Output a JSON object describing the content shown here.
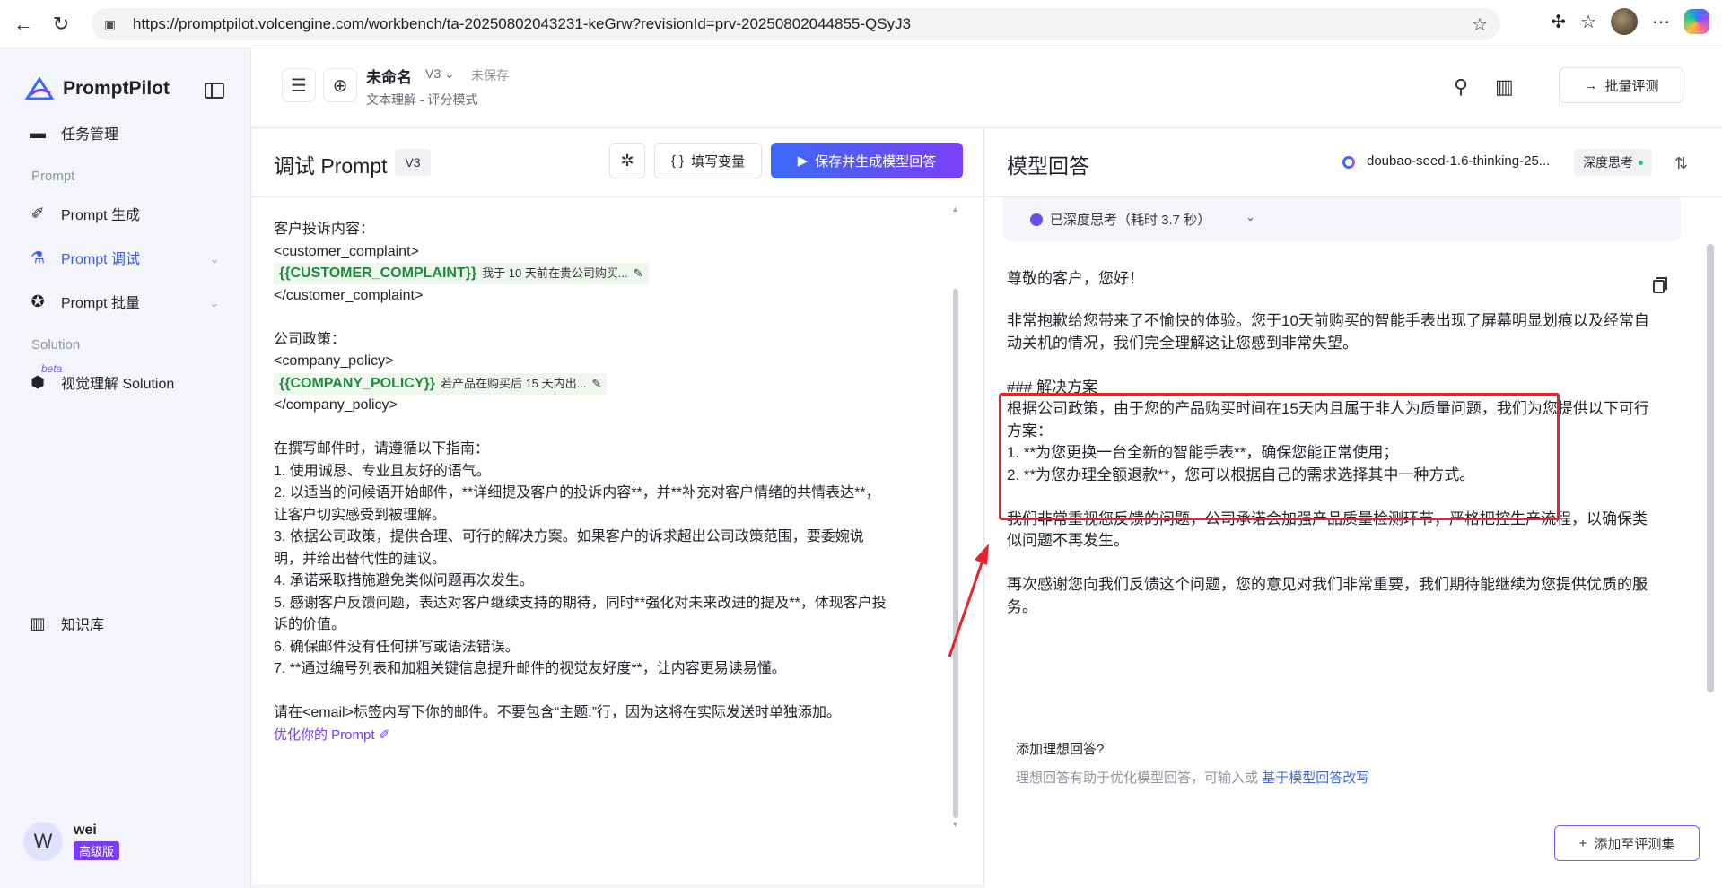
{
  "browser": {
    "url": "https://promptpilot.volcengine.com/workbench/ta-20250802043231-keGrw?revisionId=prv-20250802044855-QSyJ3"
  },
  "sidebar": {
    "logo": "PromptPilot",
    "items": [
      {
        "label": "任务管理"
      },
      {
        "label": "Prompt 生成"
      },
      {
        "label": "Prompt 调试"
      },
      {
        "label": "Prompt 批量"
      },
      {
        "label": "视觉理解 Solution"
      },
      {
        "label": "知识库"
      }
    ],
    "section_prompt": "Prompt",
    "section_solution": "Solution",
    "beta": "beta",
    "user": {
      "initial": "W",
      "name": "wei",
      "badge": "高级版"
    }
  },
  "header": {
    "title": "未命名",
    "version": "V3",
    "status": "未保存",
    "subtitle": "文本理解 - 评分模式",
    "batch_button": "批量评测"
  },
  "left": {
    "title": "调试 Prompt",
    "version": "V3",
    "fill_vars": "填写变量",
    "save_button": "保存并生成模型回答",
    "lines": {
      "l1": "客户投诉内容：",
      "l2": "<customer_complaint>",
      "var1_name": "{{CUSTOMER_COMPLAINT}}",
      "var1_val": "我于 10 天前在贵公司购买...",
      "l4": "</customer_complaint>",
      "l6": "公司政策：",
      "l7": "<company_policy>",
      "var2_name": "{{COMPANY_POLICY}}",
      "var2_val": "若产品在购买后 15 天内出...",
      "l9": "</company_policy>",
      "l11": "在撰写邮件时，请遵循以下指南：",
      "l12": "1. 使用诚恳、专业且友好的语气。",
      "l13": "2. 以适当的问候语开始邮件，**详细提及客户的投诉内容**，并**补充对客户情绪的共情表达**，",
      "l14": "让客户切实感受到被理解。",
      "l15": "3. 依据公司政策，提供合理、可行的解决方案。如果客户的诉求超出公司政策范围，要委婉说",
      "l16": "明，并给出替代性的建议。",
      "l17": "4. 承诺采取措施避免类似问题再次发生。",
      "l18": "5. 感谢客户反馈问题，表达对客户继续支持的期待，同时**强化对未来改进的提及**，体现客户投",
      "l19": "诉的价值。",
      "l20": "6. 确保邮件没有任何拼写或语法错误。",
      "l21": "7. **通过编号列表和加粗关键信息提升邮件的视觉友好度**，让内容更易读易懂。",
      "l23": "请在<email>标签内写下你的邮件。不要包含“主题:”行，因为这将在实际发送时单独添加。"
    },
    "optimize": "优化你的 Prompt"
  },
  "right": {
    "title": "模型回答",
    "model": "doubao-seed-1.6-thinking-25...",
    "think_tag": "深度思考",
    "thought": "已深度思考（耗时 3.7 秒）",
    "answer": {
      "a1": "尊敬的客户，您好！",
      "a2": "非常抱歉给您带来了不愉快的体验。您于10天前购买的智能手表出现了屏幕明显划痕以及经常自",
      "a3": "动关机的情况，我们完全理解这让您感到非常失望。",
      "a4": "### 解决方案",
      "a5": "根据公司政策，由于您的产品购买时间在15天内且属于非人为质量问题，我们为您提供以下可行",
      "a6": "方案：",
      "a7": "1. **为您更换一台全新的智能手表**，确保您能正常使用；",
      "a8": "2. **为您办理全额退款**，您可以根据自己的需求选择其中一种方式。",
      "a9": "我们非常重视您反馈的问题，公司承诺会加强产品质量检测环节，严格把控生产流程，以确保类",
      "a10": "似问题不再发生。",
      "a11": "再次感谢您向我们反馈这个问题，您的意见对我们非常重要，我们期待能继续为您提供优质的服",
      "a12": "务。"
    },
    "ideal_title": "添加理想回答?",
    "ideal_sub": "理想回答有助于优化模型回答，可输入或",
    "ideal_link": "基于模型回答改写",
    "add_eval": "添加至评测集"
  },
  "colors": {
    "accent": "#3a5bf0",
    "highlight": "#e8232b",
    "var_green": "#1d8a3a",
    "badge_purple": "#7a3cf5"
  }
}
